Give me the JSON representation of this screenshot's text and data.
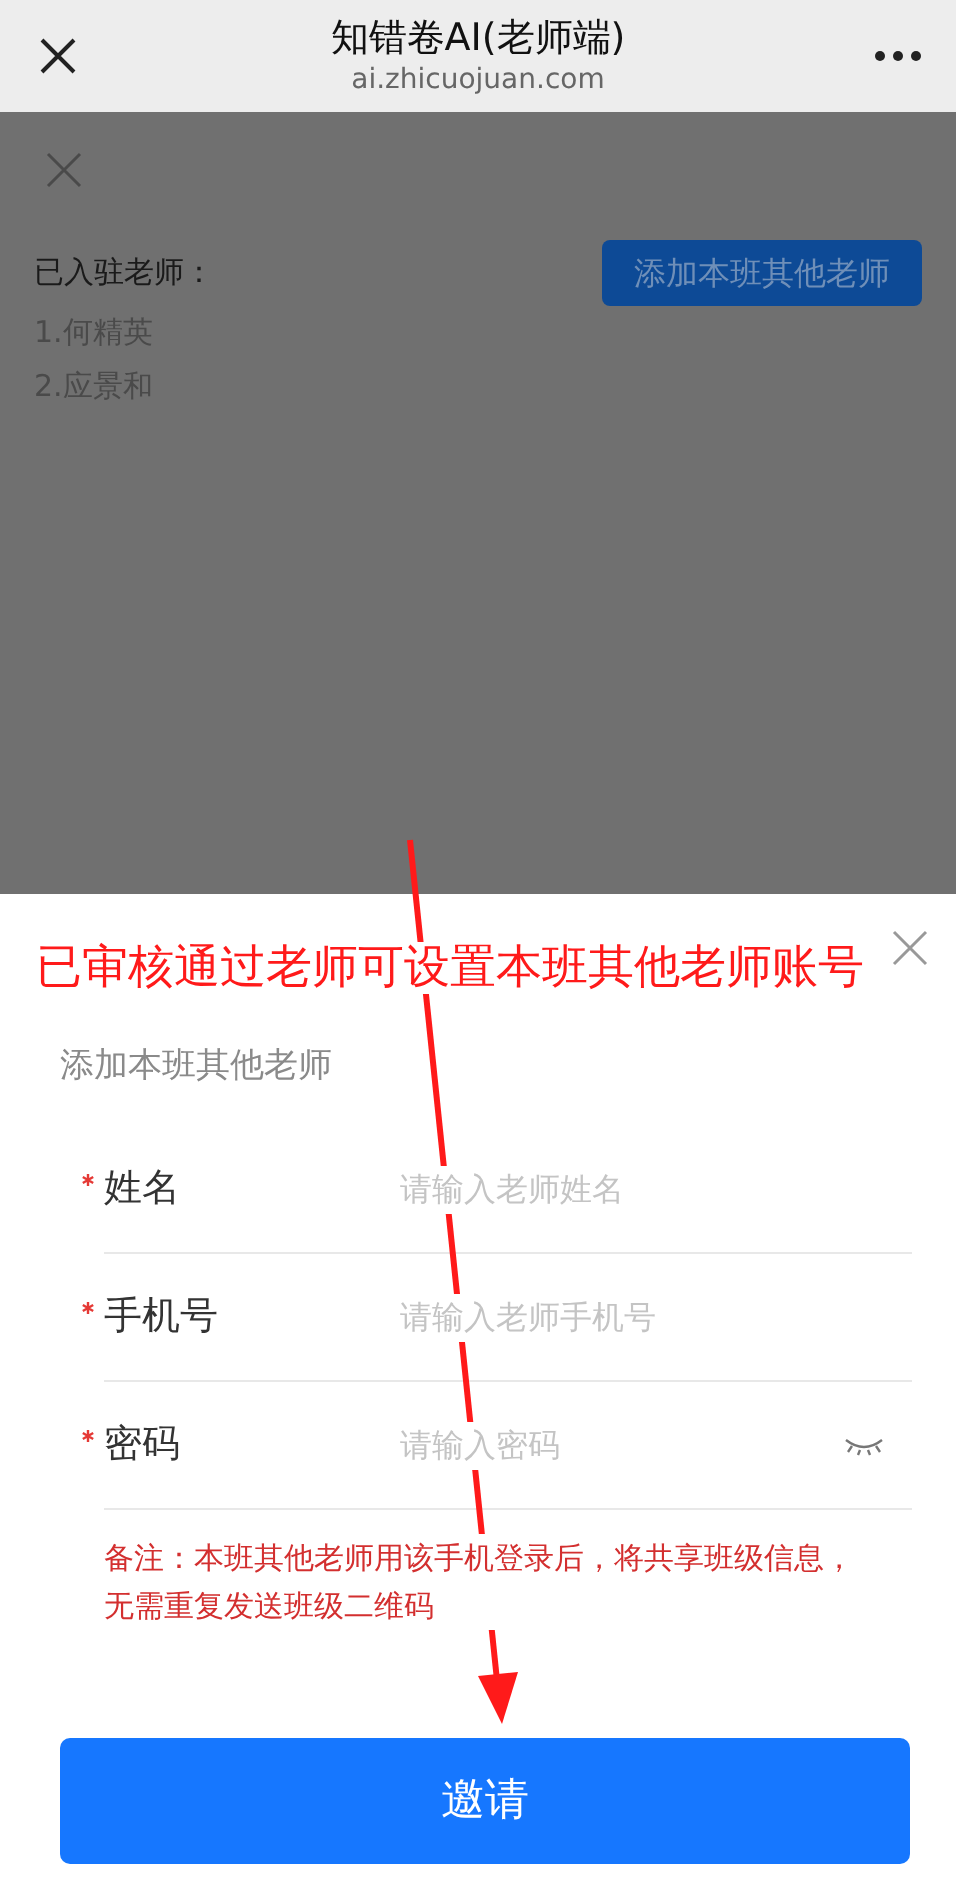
{
  "browser_bar": {
    "title": "知错卷AI(老师端)",
    "url": "ai.zhicuojuan.com"
  },
  "background_page": {
    "label": "已入驻老师：",
    "teachers": [
      "1.何精英",
      "2.应景和"
    ],
    "add_button": "添加本班其他老师"
  },
  "annotation": "已审核通过老师可设置本班其他老师账号",
  "sheet": {
    "title": "添加本班其他老师",
    "fields": [
      {
        "kind": "text",
        "label": "姓名",
        "placeholder": "请输入老师姓名",
        "required": true
      },
      {
        "kind": "text",
        "label": "手机号",
        "placeholder": "请输入老师手机号",
        "required": true
      },
      {
        "kind": "password",
        "label": "密码",
        "placeholder": "请输入密码",
        "required": true
      }
    ],
    "note": "备注：本班其他老师用该手机登录后，将共享班级信息，无需重复发送班级二维码",
    "submit_button": "邀请"
  }
}
